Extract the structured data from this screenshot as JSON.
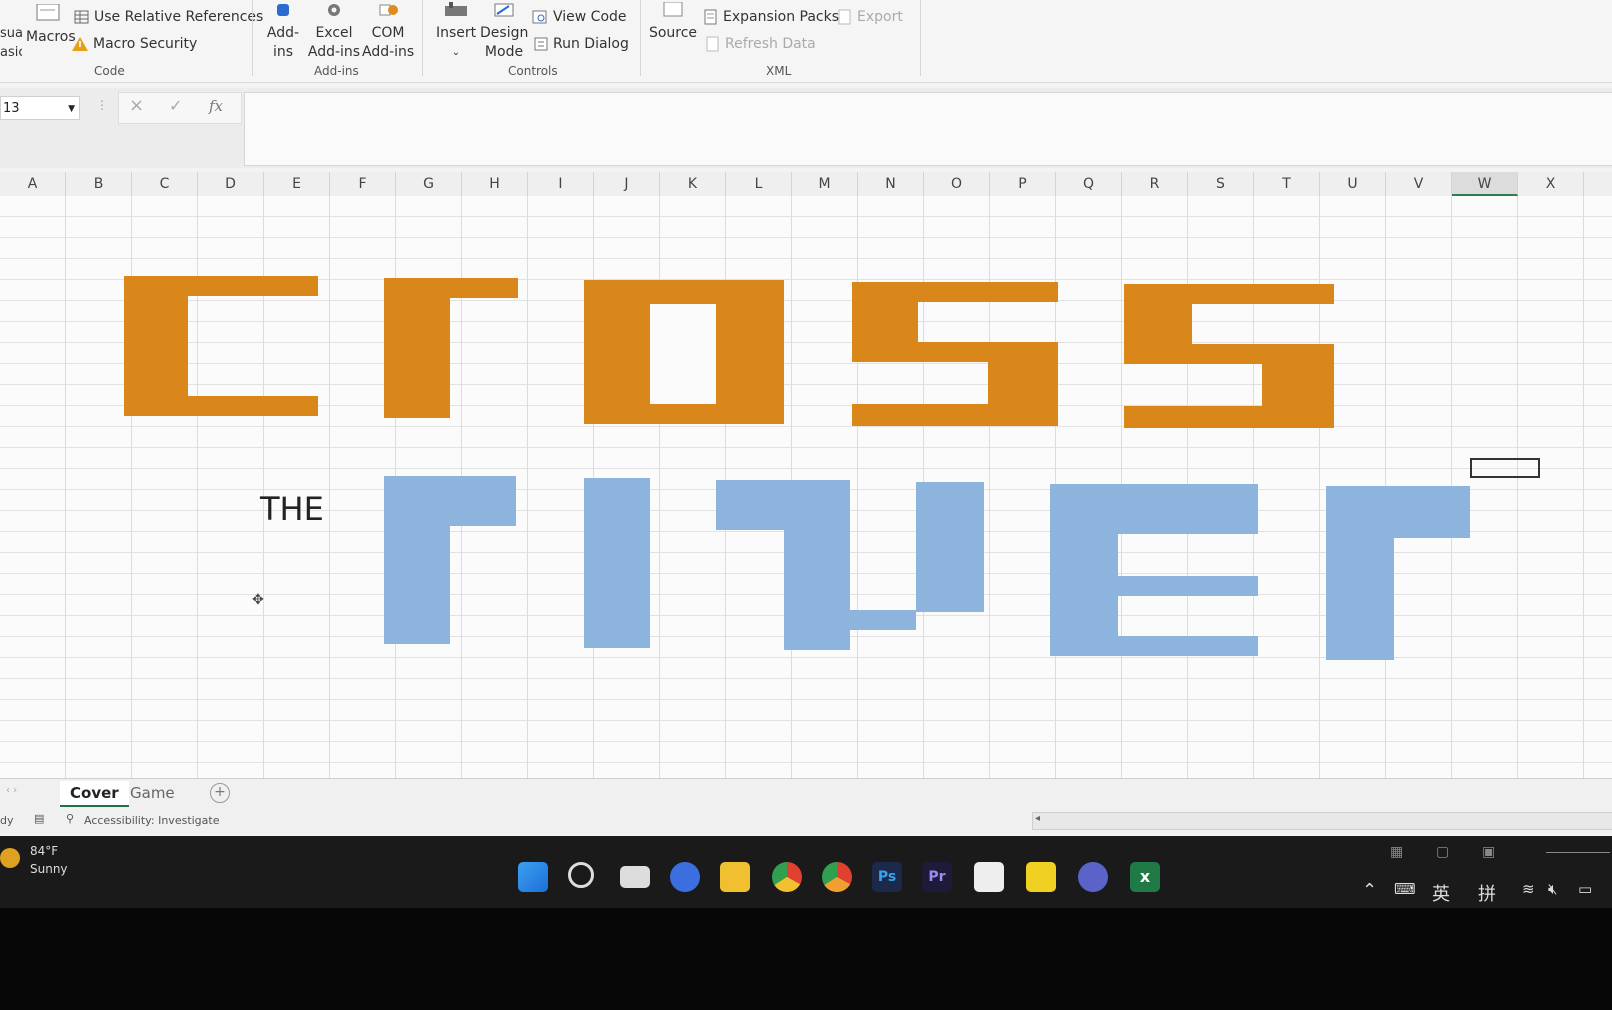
{
  "ribbon": {
    "code": {
      "visual_basic_label": "sual\nasic",
      "macros_label": "Macros",
      "use_relative_references": "Use Relative References",
      "macro_security": "Macro Security",
      "group_label": "Code"
    },
    "addins": {
      "addins_label": "Add-\nins",
      "excel_addins_label": "Excel\nAdd-ins",
      "com_addins_label": "COM\nAdd-ins",
      "group_label": "Add-ins"
    },
    "controls": {
      "insert_label": "Insert",
      "design_mode_label": "Design\nMode",
      "view_code": "View Code",
      "run_dialog": "Run Dialog",
      "group_label": "Controls"
    },
    "xml": {
      "source_label": "Source",
      "expansion_packs": "Expansion Packs",
      "export": "Export",
      "refresh_data": "Refresh Data",
      "group_label": "XML"
    }
  },
  "formula_bar": {
    "name_box": "13",
    "cancel_icon": "×",
    "enter_icon": "✓",
    "fx_icon": "fx",
    "value": ""
  },
  "columns": [
    "A",
    "B",
    "C",
    "D",
    "E",
    "F",
    "G",
    "H",
    "I",
    "J",
    "K",
    "L",
    "M",
    "N",
    "O",
    "P",
    "Q",
    "R",
    "S",
    "T",
    "U",
    "V",
    "W",
    "X"
  ],
  "selected_column": "W",
  "sheet": {
    "title_word_1": "cross",
    "small_word": "THE",
    "title_word_2": "river",
    "colors": {
      "orange": "#d9861b",
      "blue": "#8db4dc"
    }
  },
  "sheet_tabs": [
    {
      "label": "Cover",
      "active": true
    },
    {
      "label": "Game",
      "active": false
    }
  ],
  "status": {
    "ready": "dy",
    "accessibility": "Accessibility: Investigate"
  },
  "taskbar": {
    "weather_temp": "84°F",
    "weather_desc": "Sunny",
    "icons": [
      "windows-icon",
      "search-icon",
      "task-view-icon",
      "meet-icon",
      "file-explorer-icon",
      "chrome-icon",
      "chrome-dev-icon",
      "photoshop-icon",
      "premiere-icon",
      "capcut-icon",
      "sticky-notes-icon",
      "github-icon",
      "excel-icon"
    ],
    "ps_label": "Ps",
    "pr_label": "Pr",
    "ime_en": "英",
    "ime_pin": "拼"
  }
}
